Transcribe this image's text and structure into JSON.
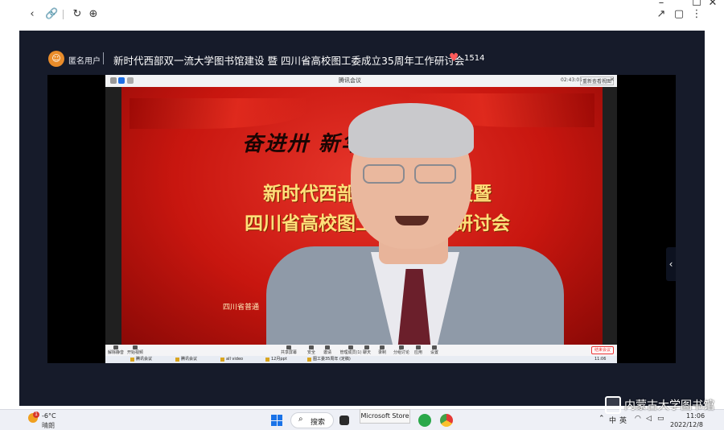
{
  "live_header": {
    "user_name": "匿名用户",
    "title": "新时代西部双一流大学图书馆建设 暨 四川省高校图工委成立35周年工作研讨会",
    "like_count": "1514"
  },
  "meeting": {
    "window_title": "腾讯会议",
    "elapsed_time": "02:43:01",
    "view_button": "重新查看视图",
    "backdrop": {
      "slogan": "奋进卅 新华章",
      "headline_line1": "新时代西部双一 书馆建设暨",
      "headline_line2": "四川省高校图工委 年工作研讨会",
      "sub1": "四川",
      "sub2": "四川省普通"
    },
    "controls": [
      "解除静音",
      "开始视频",
      "共享屏幕",
      "安全",
      "邀请",
      "管理成员(1)",
      "聊天",
      "录制",
      "分组讨论",
      "应用",
      "设置"
    ],
    "end_button": "结束会议",
    "inner_taskbar": [
      "腾讯会议",
      "腾讯会议",
      "all video",
      "12月ppt",
      "图工委35周年 (定稿)"
    ],
    "inner_clock": "11:06"
  },
  "taskbar": {
    "weather_badge": "1",
    "temperature": "-6°C",
    "weather": "晴朗",
    "search_label": "搜索",
    "tooltip": "Microsoft Store",
    "lang_1": "中",
    "lang_2": "英",
    "time": "11:06",
    "date": "2022/12/8"
  },
  "watermark": "内蒙古大学图书馆"
}
